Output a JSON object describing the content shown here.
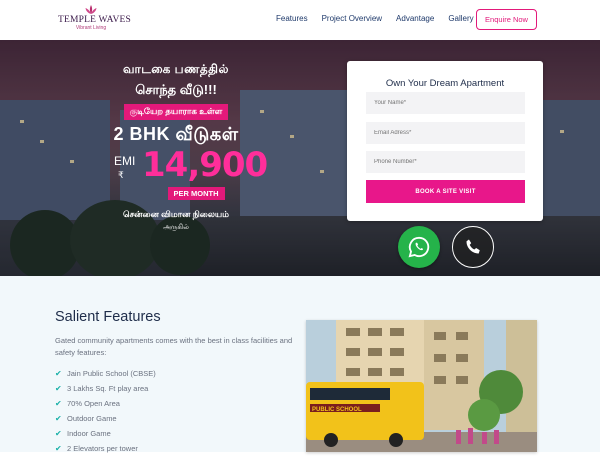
{
  "brand": {
    "name": "TEMPLE WAVES",
    "tagline": "Vibrant Living",
    "accent": "#e3197a"
  },
  "nav": {
    "items": [
      {
        "label": "Features"
      },
      {
        "label": "Project Overview"
      },
      {
        "label": "Advantage"
      },
      {
        "label": "Gallery"
      }
    ],
    "enquire_label": "Enquire Now"
  },
  "hero": {
    "line1": "வாடகை பணத்தில்",
    "line2": "சொந்த வீடு!!!",
    "line3": "குடியேற தயாராக உள்ள",
    "line4": "2 BHK வீடுகள்",
    "emi_label": "EMI",
    "rupee": "₹",
    "emi_value": "14,900",
    "per_month": "PER MONTH",
    "line5": "சென்னை விமான நிலையம்",
    "line6": "அருகில்"
  },
  "form": {
    "title": "Own Your Dream Apartment",
    "name_placeholder": "Your Name*",
    "email_placeholder": "Email Adress*",
    "phone_placeholder": "Phone Number*",
    "submit_label": "BOOK A SITE VISIT"
  },
  "contact_icons": {
    "whatsapp": "whatsapp-icon",
    "phone": "phone-icon"
  },
  "features": {
    "title": "Salient Features",
    "description": "Gated community apartments comes with the best in class facilities and safety features:",
    "items": [
      {
        "label": "Jain Public School (CBSE)"
      },
      {
        "label": "3 Lakhs Sq. Ft play area"
      },
      {
        "label": "70% Open Area"
      },
      {
        "label": "Outdoor Game"
      },
      {
        "label": "Indoor Game"
      },
      {
        "label": "2 Elevators per tower"
      }
    ],
    "photo_bus_text": "PUBLIC SCHOOL"
  }
}
